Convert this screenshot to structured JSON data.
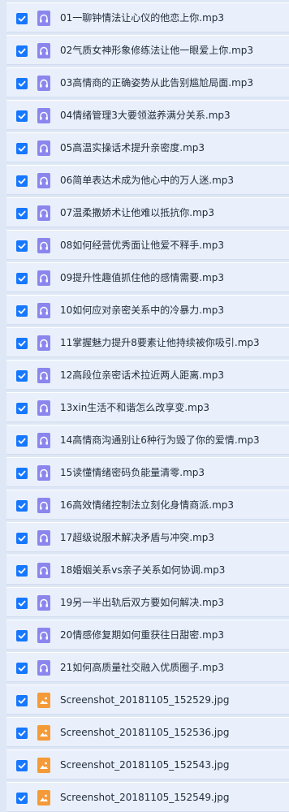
{
  "files": [
    {
      "name": "01一聊钟情法让心仪的他恋上你.mp3",
      "icon": "audio-file-icon",
      "checked": true
    },
    {
      "name": "02气质女神形象修练法让他一眼爱上你.mp3",
      "icon": "audio-file-icon",
      "checked": true
    },
    {
      "name": "03高情商的正确姿势从此告别尴尬局面.mp3",
      "icon": "audio-file-icon",
      "checked": true
    },
    {
      "name": "04情绪管理3大要领滋养满分关系.mp3",
      "icon": "audio-file-icon",
      "checked": true
    },
    {
      "name": "05高温实操话术提升亲密度.mp3",
      "icon": "audio-file-icon",
      "checked": true
    },
    {
      "name": "06简单表达术成为他心中的万人迷.mp3",
      "icon": "audio-file-icon",
      "checked": true
    },
    {
      "name": "07温柔撒娇术让他难以抵抗你.mp3",
      "icon": "audio-file-icon",
      "checked": true
    },
    {
      "name": "08如何经营优秀面让他爱不释手.mp3",
      "icon": "audio-file-icon",
      "checked": true
    },
    {
      "name": "09提升性趣值抓住他的感情需要.mp3",
      "icon": "audio-file-icon",
      "checked": true
    },
    {
      "name": "10如何应对亲密关系中的冷暴力.mp3",
      "icon": "audio-file-icon",
      "checked": true
    },
    {
      "name": "11掌握魅力提升8要素让他持续被你吸引.mp3",
      "icon": "audio-file-icon",
      "checked": true
    },
    {
      "name": "12高段位亲密话术拉近两人距离.mp3",
      "icon": "audio-file-icon",
      "checked": true
    },
    {
      "name": "13xin生活不和谐怎么改享变.mp3",
      "icon": "audio-file-icon",
      "checked": true
    },
    {
      "name": "14高情商沟通别让6种行为毁了你的爱情.mp3",
      "icon": "audio-file-icon",
      "checked": true
    },
    {
      "name": "15读懂情绪密码负能量清零.mp3",
      "icon": "audio-file-icon",
      "checked": true
    },
    {
      "name": "16高效情绪控制法立刻化身情商派.mp3",
      "icon": "audio-file-icon",
      "checked": true
    },
    {
      "name": "17超级说服术解决矛盾与冲突.mp3",
      "icon": "audio-file-icon",
      "checked": true
    },
    {
      "name": "18婚姻关系vs亲子关系如何协调.mp3",
      "icon": "audio-file-icon",
      "checked": true
    },
    {
      "name": "19另一半出轨后双方要如何解决.mp3",
      "icon": "audio-file-icon",
      "checked": true
    },
    {
      "name": "20情感修复期如何重获往日甜密.mp3",
      "icon": "audio-file-icon",
      "checked": true
    },
    {
      "name": "21如何高质量社交融入优质圈子.mp3",
      "icon": "audio-file-icon",
      "checked": true
    },
    {
      "name": "Screenshot_20181105_152529.jpg",
      "icon": "image-file-icon",
      "checked": true
    },
    {
      "name": "Screenshot_20181105_152536.jpg",
      "icon": "image-file-icon",
      "checked": true
    },
    {
      "name": "Screenshot_20181105_152543.jpg",
      "icon": "image-file-icon",
      "checked": true
    },
    {
      "name": "Screenshot_20181105_152549.jpg",
      "icon": "image-file-icon",
      "checked": true
    }
  ],
  "colors": {
    "checkbox": "#1677ff",
    "audio_icon": "#8b86ee",
    "image_icon": "#f59a38",
    "row_bg": "#e9f0fb"
  }
}
